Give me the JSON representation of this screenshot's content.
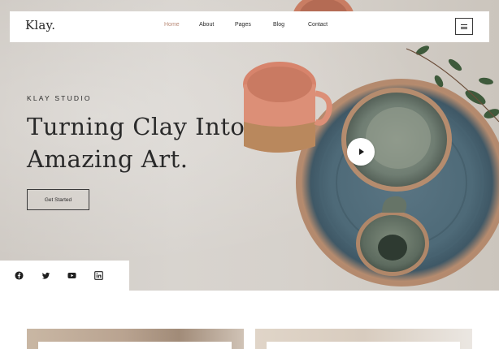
{
  "brand": {
    "logo_text": "Klay."
  },
  "nav": {
    "items": [
      {
        "label": "Home",
        "active": true
      },
      {
        "label": "About",
        "active": false
      },
      {
        "label": "Pages",
        "active": false
      },
      {
        "label": "Blog",
        "active": false
      },
      {
        "label": "Contact",
        "active": false
      }
    ],
    "menu_icon": "hamburger-icon"
  },
  "hero": {
    "eyebrow": "KLAY STUDIO",
    "headline_line1": "Turning Clay Into",
    "headline_line2": "Amazing Art.",
    "cta_label": "Get Started",
    "play_icon": "play-icon"
  },
  "social": {
    "icons": [
      "facebook-icon",
      "twitter-icon",
      "youtube-icon",
      "linkedin-icon"
    ]
  },
  "colors": {
    "accent": "#b98a77",
    "text": "#2a2a2a",
    "background": "#ffffff"
  }
}
